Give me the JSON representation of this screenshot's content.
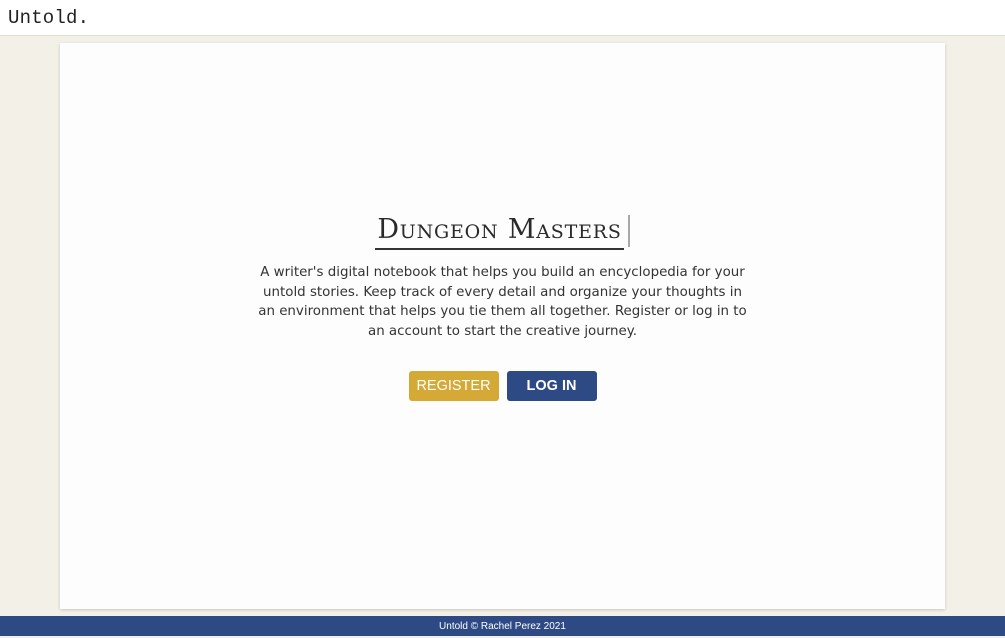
{
  "header": {
    "brand": "Untold."
  },
  "hero": {
    "title": "Dungeon Masters",
    "description": "A writer's digital notebook that helps you build an encyclopedia for your untold stories. Keep track of every detail and organize your thoughts in an environment that helps you tie them all together. Register or log in to an account to start the creative journey."
  },
  "actions": {
    "register_label": "REGISTER",
    "login_label": "LOG IN"
  },
  "footer": {
    "text": "Untold © Rachel Perez 2021"
  },
  "colors": {
    "background": "#f3f0e8",
    "register": "#d4a935",
    "login": "#2e4a85",
    "footer": "#2e4a85"
  }
}
